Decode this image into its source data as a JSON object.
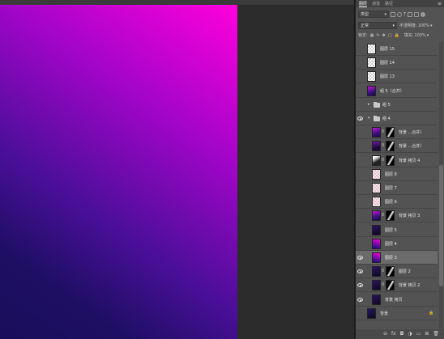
{
  "panel": {
    "tabs": [
      "图层",
      "通道",
      "路径"
    ],
    "menu_icon": "panel-menu-icon",
    "filter": {
      "kind_label": "类型",
      "filter_icons": [
        "image-filter-icon",
        "adjustment-filter-icon",
        "type-filter-icon",
        "shape-filter-icon",
        "smart-object-filter-icon"
      ]
    },
    "blend_mode": "正常",
    "opacity_label": "不透明度:",
    "opacity_value": "100%",
    "lock_label": "锁定:",
    "fill_label": "填充:",
    "fill_value": "100%"
  },
  "layers": [
    {
      "name": "图层 15",
      "thumb": "checker",
      "visible": false
    },
    {
      "name": "图层 14",
      "thumb": "checker",
      "visible": false
    },
    {
      "name": "图层 13",
      "thumb": "checker",
      "visible": false
    },
    {
      "name": "组 5（合并）",
      "thumb": "purple",
      "visible": false
    },
    {
      "name": "组 5",
      "type": "group",
      "collapsed": true,
      "visible": false
    },
    {
      "name": "组 4",
      "type": "group",
      "collapsed": false,
      "visible": true
    },
    {
      "name": "背景 ...合并）",
      "thumb": "purple",
      "mask": true,
      "visible": false,
      "indent": true
    },
    {
      "name": "背景 ...合并）",
      "thumb": "purple-dark",
      "mask": true,
      "visible": false,
      "indent": true
    },
    {
      "name": "背景 拷贝 4",
      "thumb": "bw",
      "mask": true,
      "visible": false,
      "indent": true
    },
    {
      "name": "图层 8",
      "thumb": "checker-pink",
      "visible": false,
      "indent": true
    },
    {
      "name": "图层 7",
      "thumb": "checker-pink",
      "visible": false,
      "indent": true
    },
    {
      "name": "图层 6",
      "thumb": "checker-pink",
      "visible": false,
      "indent": true
    },
    {
      "name": "背景 拷贝 3",
      "thumb": "purple",
      "mask": true,
      "visible": false,
      "indent": true
    },
    {
      "name": "图层 5",
      "thumb": "dark",
      "visible": false,
      "indent": true
    },
    {
      "name": "图层 4",
      "thumb": "magenta",
      "visible": false,
      "indent": true
    },
    {
      "name": "图层 3",
      "thumb": "magenta",
      "visible": true,
      "selected": true,
      "indent": true
    },
    {
      "name": "图层 2",
      "thumb": "dark",
      "mask": true,
      "visible": true,
      "indent": true
    },
    {
      "name": "背景 拷贝 2",
      "thumb": "dark",
      "mask": true,
      "visible": true,
      "indent": true
    },
    {
      "name": "背景 拷贝",
      "thumb": "dark",
      "visible": true,
      "indent": true
    },
    {
      "name": "背景",
      "thumb": "dark",
      "visible": false,
      "locked": true
    }
  ],
  "bottom_icons": [
    "link-layers-icon",
    "fx-icon",
    "mask-icon",
    "adjustment-icon",
    "group-icon",
    "new-layer-icon",
    "trash-icon"
  ],
  "bottom_glyphs": [
    "⊖",
    "fx",
    "◘",
    "◑",
    "▭",
    "⊞",
    "🗑"
  ]
}
